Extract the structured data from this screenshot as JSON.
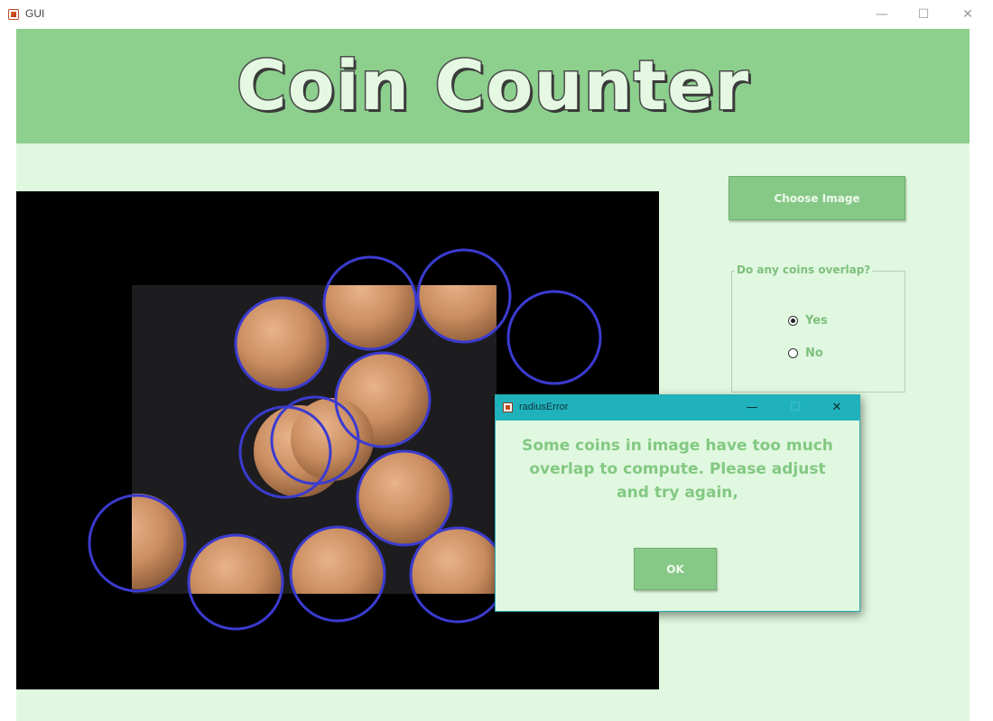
{
  "window": {
    "title": "GUI",
    "minimize_glyph": "—",
    "maximize_glyph": "☐",
    "close_glyph": "✕"
  },
  "app": {
    "heading": "Coin Counter",
    "choose_image_label": "Choose Image",
    "overlap_group": {
      "title": "Do any coins overlap?",
      "options": [
        {
          "label": "Yes",
          "selected": true
        },
        {
          "label": "No",
          "selected": false
        }
      ]
    },
    "image": {
      "content": "photo of pennies on a dark background with blue detection circles",
      "detected_circle_color": "#3b3bd0"
    }
  },
  "dialog": {
    "title": "radiusError",
    "message": "Some coins in image have too much overlap to compute. Please adjust and try again,",
    "message_lines": [
      "Some coins in image have too much",
      "overlap to compute. Please adjust",
      "and try again,"
    ],
    "ok_label": "OK",
    "minimize_glyph": "—",
    "maximize_glyph": "☐",
    "close_glyph": "✕"
  },
  "colors": {
    "banner": "#8dcf8d",
    "background": "#e0f8df",
    "button": "#86c987",
    "dialog_titlebar": "#1fb2bd"
  },
  "icons": [
    "app-icon",
    "minimize-icon",
    "maximize-icon",
    "close-icon"
  ]
}
